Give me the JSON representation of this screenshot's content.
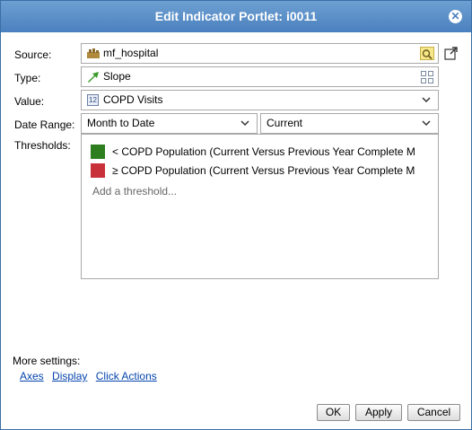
{
  "dialog": {
    "title": "Edit Indicator Portlet: i0011"
  },
  "form": {
    "source_label": "Source:",
    "source_value": "mf_hospital",
    "type_label": "Type:",
    "type_value": "Slope",
    "value_label": "Value:",
    "value_value": "COPD Visits",
    "value_icon_text": "12",
    "date_range_label": "Date Range:",
    "date_range_period": "Month to Date",
    "date_range_comparison": "Current",
    "thresholds_label": "Thresholds:"
  },
  "thresholds": {
    "items": [
      {
        "text": "< COPD Population (Current Versus Previous Year Complete M",
        "color": "#2e7d1e"
      },
      {
        "text": "≥ COPD Population (Current Versus Previous Year Complete M",
        "color": "#c8313a"
      }
    ],
    "add_label": "Add a threshold..."
  },
  "more_settings": {
    "label": "More settings:",
    "links": [
      "Axes",
      "Display",
      "Click Actions"
    ]
  },
  "buttons": {
    "ok": "OK",
    "apply": "Apply",
    "cancel": "Cancel"
  },
  "colors": {
    "title_bar": "#4a80bf",
    "link": "#0645ad"
  },
  "icons": {
    "close": "close-icon",
    "popout": "popout-icon",
    "source": "database-icon",
    "lookup": "search-icon",
    "type": "slope-icon",
    "grid": "grid-icon",
    "value": "number-icon"
  }
}
